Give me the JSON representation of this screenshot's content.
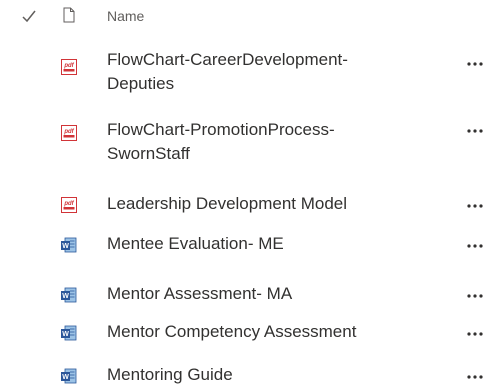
{
  "header": {
    "select_all_icon": "checkmark-icon",
    "file_type_icon": "document-icon",
    "name_column": "Name"
  },
  "files": [
    {
      "name": "FlowChart-CareerDevelopment-Deputies",
      "line1": "FlowChart-CareerDevelopment-",
      "line2": "Deputies",
      "type": "pdf"
    },
    {
      "name": "FlowChart-PromotionProcess-SwornStaff",
      "line1": "FlowChart-PromotionProcess-",
      "line2": "SwornStaff",
      "type": "pdf"
    },
    {
      "name": "Leadership Development Model",
      "line1": "Leadership Development Model",
      "line2": "",
      "type": "pdf"
    },
    {
      "name": "Mentee Evaluation- ME",
      "line1": "Mentee Evaluation- ME",
      "line2": "",
      "type": "word"
    },
    {
      "name": "Mentor Assessment- MA",
      "line1": "Mentor Assessment- MA",
      "line2": "",
      "type": "word"
    },
    {
      "name": "Mentor Competency Assessment",
      "line1": "Mentor Competency Assessment",
      "line2": "",
      "type": "word"
    },
    {
      "name": "Mentoring Guide",
      "line1": "Mentoring Guide",
      "line2": "",
      "type": "word"
    }
  ],
  "colors": {
    "pdf_red": "#d13438",
    "word_blue": "#2b579a",
    "text": "#323130",
    "muted": "#605e5c"
  }
}
